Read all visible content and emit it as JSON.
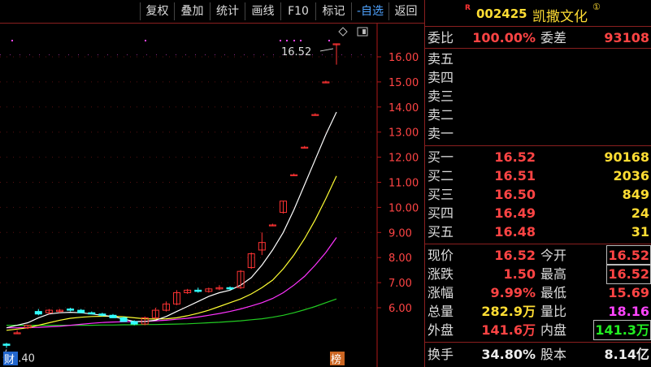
{
  "toolbar": {
    "buttons": [
      "复权",
      "叠加",
      "统计",
      "画线",
      "F10",
      "标记",
      "-自选",
      "返回"
    ]
  },
  "chart": {
    "price_ticks": [
      "16.00",
      "15.00",
      "14.00",
      "13.00",
      "12.00",
      "11.00",
      "10.00",
      "9.00",
      "8.00",
      "7.00",
      "6.00"
    ],
    "last_price_label": "16.52",
    "low_price_label": "4.40",
    "marker_left": "财",
    "marker_right": "榜",
    "colors": {
      "up": "#ff3333",
      "down": "#33ffff",
      "ma5": "#ffffff",
      "ma10": "#ffff33",
      "ma20": "#ff33ff",
      "ma60": "#22cc22",
      "axis": "#b01818"
    }
  },
  "chart_data": {
    "type": "candlestick",
    "ylim": [
      4.3,
      16.8
    ],
    "candles": [
      {
        "o": 4.55,
        "h": 4.6,
        "l": 4.4,
        "c": 4.5
      },
      {
        "o": 5.0,
        "h": 5.1,
        "l": 4.95,
        "c": 5.0
      },
      {
        "o": 5.2,
        "h": 5.3,
        "l": 5.15,
        "c": 5.3
      },
      {
        "o": 5.85,
        "h": 5.95,
        "l": 5.7,
        "c": 5.75
      },
      {
        "o": 5.8,
        "h": 5.95,
        "l": 5.75,
        "c": 5.9
      },
      {
        "o": 5.85,
        "h": 5.95,
        "l": 5.8,
        "c": 5.9
      },
      {
        "o": 5.95,
        "h": 6.0,
        "l": 5.85,
        "c": 5.9
      },
      {
        "o": 5.9,
        "h": 5.95,
        "l": 5.8,
        "c": 5.8
      },
      {
        "o": 5.8,
        "h": 5.85,
        "l": 5.75,
        "c": 5.75
      },
      {
        "o": 5.75,
        "h": 5.8,
        "l": 5.65,
        "c": 5.7
      },
      {
        "o": 5.7,
        "h": 5.75,
        "l": 5.6,
        "c": 5.6
      },
      {
        "o": 5.6,
        "h": 5.65,
        "l": 5.45,
        "c": 5.45
      },
      {
        "o": 5.45,
        "h": 5.5,
        "l": 5.3,
        "c": 5.35
      },
      {
        "o": 5.35,
        "h": 5.65,
        "l": 5.3,
        "c": 5.6
      },
      {
        "o": 5.6,
        "h": 6.0,
        "l": 5.55,
        "c": 5.9
      },
      {
        "o": 5.9,
        "h": 6.25,
        "l": 5.85,
        "c": 6.15
      },
      {
        "o": 6.15,
        "h": 6.7,
        "l": 6.1,
        "c": 6.6
      },
      {
        "o": 6.6,
        "h": 6.75,
        "l": 6.55,
        "c": 6.7
      },
      {
        "o": 6.7,
        "h": 6.8,
        "l": 6.6,
        "c": 6.65
      },
      {
        "o": 6.65,
        "h": 6.8,
        "l": 6.6,
        "c": 6.75
      },
      {
        "o": 6.75,
        "h": 6.9,
        "l": 6.7,
        "c": 6.8
      },
      {
        "o": 6.8,
        "h": 6.85,
        "l": 6.7,
        "c": 6.75
      },
      {
        "o": 6.8,
        "h": 7.5,
        "l": 6.75,
        "c": 7.45
      },
      {
        "o": 7.6,
        "h": 8.2,
        "l": 7.55,
        "c": 8.15
      },
      {
        "o": 8.3,
        "h": 9.0,
        "l": 8.1,
        "c": 8.6
      },
      {
        "o": 9.3,
        "h": 9.35,
        "l": 9.25,
        "c": 9.3
      },
      {
        "o": 9.8,
        "h": 10.25,
        "l": 9.75,
        "c": 10.25
      },
      {
        "o": 11.3,
        "h": 11.35,
        "l": 11.25,
        "c": 11.3
      },
      {
        "o": 12.4,
        "h": 12.45,
        "l": 12.35,
        "c": 12.4
      },
      {
        "o": 13.7,
        "h": 13.75,
        "l": 13.65,
        "c": 13.7
      },
      {
        "o": 15.0,
        "h": 15.05,
        "l": 14.95,
        "c": 15.0
      },
      {
        "o": 16.52,
        "h": 16.52,
        "l": 15.69,
        "c": 16.52
      }
    ],
    "ma5": [
      5.2,
      5.3,
      5.4,
      5.6,
      5.75,
      5.8,
      5.82,
      5.8,
      5.75,
      5.7,
      5.65,
      5.55,
      5.45,
      5.45,
      5.5,
      5.65,
      5.85,
      6.05,
      6.25,
      6.45,
      6.6,
      6.7,
      6.9,
      7.2,
      7.7,
      8.3,
      9.0,
      9.9,
      10.9,
      11.9,
      12.9,
      13.8
    ],
    "ma10": [
      5.1,
      5.15,
      5.2,
      5.3,
      5.4,
      5.5,
      5.58,
      5.62,
      5.65,
      5.66,
      5.66,
      5.64,
      5.6,
      5.56,
      5.55,
      5.56,
      5.6,
      5.68,
      5.78,
      5.9,
      6.05,
      6.2,
      6.35,
      6.55,
      6.8,
      7.1,
      7.55,
      8.1,
      8.75,
      9.5,
      10.35,
      11.25
    ],
    "ma20": [
      5.2,
      5.2,
      5.21,
      5.22,
      5.24,
      5.26,
      5.3,
      5.34,
      5.38,
      5.41,
      5.43,
      5.44,
      5.45,
      5.46,
      5.48,
      5.5,
      5.54,
      5.58,
      5.63,
      5.7,
      5.77,
      5.85,
      5.95,
      6.07,
      6.2,
      6.37,
      6.6,
      6.9,
      7.25,
      7.7,
      8.2,
      8.8
    ],
    "ma60": [
      5.3,
      5.3,
      5.3,
      5.3,
      5.3,
      5.3,
      5.3,
      5.3,
      5.3,
      5.31,
      5.31,
      5.32,
      5.32,
      5.33,
      5.33,
      5.34,
      5.35,
      5.36,
      5.38,
      5.4,
      5.42,
      5.45,
      5.48,
      5.52,
      5.56,
      5.62,
      5.7,
      5.8,
      5.92,
      6.05,
      6.2,
      6.35
    ]
  },
  "quote": {
    "r_mark": "R",
    "code": "002425",
    "name": "凯撒文化",
    "name_mark": "①",
    "weibi_label": "委比",
    "weibi_value": "100.00%",
    "weicha_label": "委差",
    "weicha_value": "93108",
    "asks": [
      {
        "label": "卖五",
        "price": "",
        "volume": ""
      },
      {
        "label": "卖四",
        "price": "",
        "volume": ""
      },
      {
        "label": "卖三",
        "price": "",
        "volume": ""
      },
      {
        "label": "卖二",
        "price": "",
        "volume": ""
      },
      {
        "label": "卖一",
        "price": "",
        "volume": ""
      }
    ],
    "bids": [
      {
        "label": "买一",
        "price": "16.52",
        "volume": "90168"
      },
      {
        "label": "买二",
        "price": "16.51",
        "volume": "2036"
      },
      {
        "label": "买三",
        "price": "16.50",
        "volume": "849"
      },
      {
        "label": "买四",
        "price": "16.49",
        "volume": "24"
      },
      {
        "label": "买五",
        "price": "16.48",
        "volume": "31"
      }
    ],
    "stats": [
      {
        "l1": "现价",
        "v1": "16.52",
        "c1": "red",
        "l2": "今开",
        "v2": "16.52",
        "c2": "red",
        "box2": true
      },
      {
        "l1": "涨跌",
        "v1": "1.50",
        "c1": "red",
        "l2": "最高",
        "v2": "16.52",
        "c2": "red",
        "box2": true
      },
      {
        "l1": "涨幅",
        "v1": "9.99%",
        "c1": "red",
        "l2": "最低",
        "v2": "15.69",
        "c2": "red",
        "box2": false
      },
      {
        "l1": "总量",
        "v1": "282.9万",
        "c1": "yellow",
        "l2": "量比",
        "v2": "18.16",
        "c2": "magenta",
        "box2": false
      },
      {
        "l1": "外盘",
        "v1": "141.6万",
        "c1": "red",
        "l2": "内盘",
        "v2": "141.3万",
        "c2": "green",
        "box2": true
      }
    ],
    "turnover_label": "换手",
    "turnover_value": "34.80%",
    "shares_label": "股本",
    "shares_value": "8.14亿"
  }
}
